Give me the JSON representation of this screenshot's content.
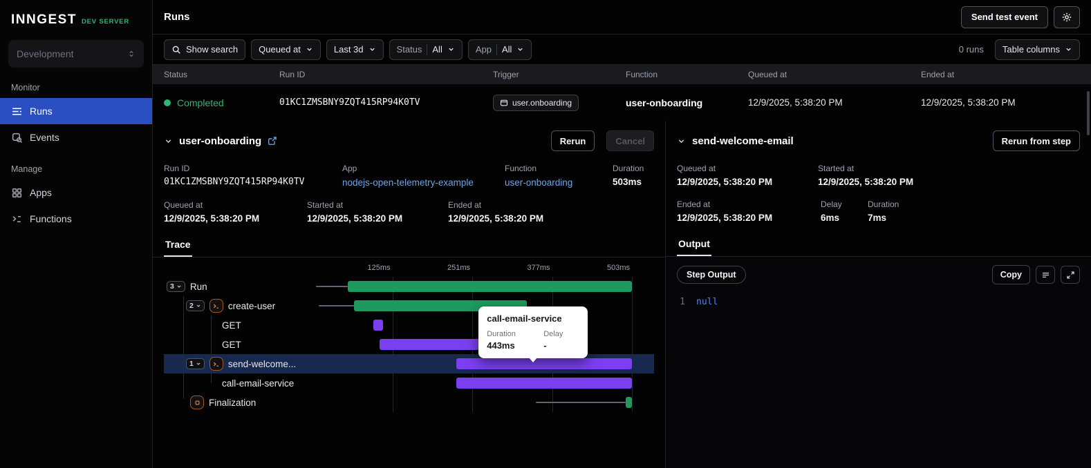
{
  "colors": {
    "green": "#1f9a5e",
    "purple": "#7b3ff2",
    "gray": "#5b6472",
    "accent_blue": "#2a4fc0",
    "status_green": "#2fb575",
    "link": "#6ba6e8"
  },
  "sidebar": {
    "logo": "INNGEST",
    "badge": "DEV SERVER",
    "env": "Development",
    "monitor": "Monitor",
    "manage": "Manage",
    "runs": "Runs",
    "events": "Events",
    "apps": "Apps",
    "functions": "Functions"
  },
  "topbar": {
    "title": "Runs",
    "send_test_event": "Send test event"
  },
  "filters": {
    "show_search": "Show search",
    "queued_at": "Queued at",
    "range": "Last 3d",
    "status_label": "Status",
    "status_value": "All",
    "app_label": "App",
    "app_value": "All",
    "runs_count": "0 runs",
    "table_columns": "Table columns"
  },
  "table": {
    "headers": [
      "Status",
      "Run ID",
      "Trigger",
      "Function",
      "Queued at",
      "Ended at"
    ],
    "row": {
      "status": "Completed",
      "run_id": "01KC1ZMSBNY9ZQT415RP94K0TV",
      "trigger": "user.onboarding",
      "function": "user-onboarding",
      "queued_at": "12/9/2025, 5:38:20 PM",
      "ended_at": "12/9/2025, 5:38:20 PM"
    }
  },
  "run_panel": {
    "title": "user-onboarding",
    "rerun": "Rerun",
    "cancel": "Cancel",
    "run_id_label": "Run ID",
    "run_id": "01KC1ZMSBNY9ZQT415RP94K0TV",
    "app_label": "App",
    "app": "nodejs-open-telemetry-example",
    "function_label": "Function",
    "function": "user-onboarding",
    "duration_label": "Duration",
    "duration": "503ms",
    "queued_label": "Queued at",
    "queued": "12/9/2025, 5:38:20 PM",
    "started_label": "Started at",
    "started": "12/9/2025, 5:38:20 PM",
    "ended_label": "Ended at",
    "ended": "12/9/2025, 5:38:20 PM",
    "tab": "Trace"
  },
  "step_panel": {
    "title": "send-welcome-email",
    "rerun_from_step": "Rerun from step",
    "queued_label": "Queued at",
    "queued": "12/9/2025, 5:38:20 PM",
    "started_label": "Started at",
    "started": "12/9/2025, 5:38:20 PM",
    "ended_label": "Ended at",
    "ended": "12/9/2025, 5:38:20 PM",
    "delay_label": "Delay",
    "delay": "6ms",
    "duration_label": "Duration",
    "duration": "7ms",
    "tab": "Output",
    "step_output": "Step Output",
    "copy": "Copy",
    "line_no": "1",
    "output_value": "null"
  },
  "trace": {
    "ticks": [
      "125ms",
      "251ms",
      "377ms",
      "503ms"
    ],
    "rows": [
      {
        "count": "3",
        "name": "Run",
        "segments": [
          {
            "type": "line",
            "color": "gray",
            "start": 1,
            "end": 11
          },
          {
            "type": "bar",
            "color": "green",
            "start": 11,
            "end": 100
          }
        ]
      },
      {
        "count": "2",
        "name": "create-user",
        "segments": [
          {
            "type": "line",
            "color": "gray",
            "start": 2,
            "end": 13
          },
          {
            "type": "bar",
            "color": "green",
            "start": 13,
            "end": 67
          }
        ]
      },
      {
        "name": "GET",
        "segments": [
          {
            "type": "bar",
            "color": "purple",
            "start": 19,
            "end": 22
          }
        ]
      },
      {
        "name": "GET",
        "segments": [
          {
            "type": "bar",
            "color": "purple",
            "start": 21,
            "end": 61
          }
        ]
      },
      {
        "count": "1",
        "name": "send-welcome...",
        "segments": [
          {
            "type": "bar",
            "color": "purple",
            "start": 45,
            "end": 100
          }
        ]
      },
      {
        "name": "call-email-service",
        "segments": [
          {
            "type": "bar",
            "color": "purple",
            "start": 45,
            "end": 100
          }
        ]
      },
      {
        "name": "Finalization",
        "segments": [
          {
            "type": "line",
            "color": "gray",
            "start": 70,
            "end": 98
          },
          {
            "type": "bar",
            "color": "green",
            "start": 98,
            "end": 100
          }
        ]
      }
    ],
    "tooltip": {
      "title": "call-email-service",
      "duration_label": "Duration",
      "delay_label": "Delay",
      "duration": "443ms",
      "delay": "-"
    }
  }
}
